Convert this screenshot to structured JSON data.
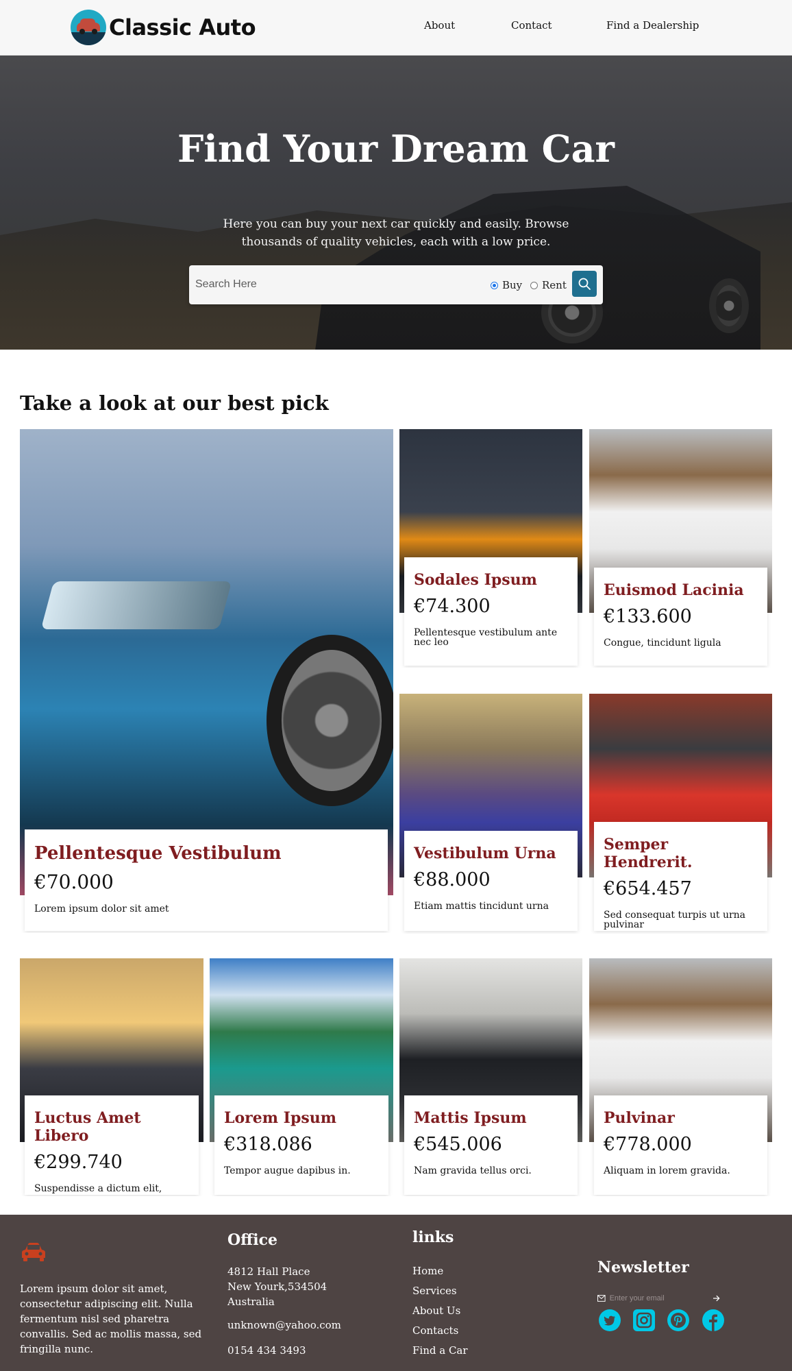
{
  "brand": {
    "name": "Classic Auto"
  },
  "nav": {
    "about": "About",
    "contact": "Contact",
    "dealership": "Find a Dealership"
  },
  "hero": {
    "title": "Find Your Dream Car",
    "subtitle": "Here you can buy your next car quickly and easily. Browse thousands of quality vehicles, each with a low price.",
    "search_placeholder": "Search Here",
    "radio_buy": "Buy",
    "radio_rent": "Rent",
    "selected_mode": "Buy"
  },
  "best_pick": {
    "title": "Take a look at our best pick",
    "featured": {
      "name": "Pellentesque Vestibulum",
      "price": "€70.000",
      "desc": "Lorem ipsum dolor sit amet"
    },
    "items": [
      {
        "name": "Sodales Ipsum",
        "price": "€74.300",
        "desc": "Pellentesque vestibulum ante nec leo"
      },
      {
        "name": "Euismod Lacinia",
        "price": "€133.600",
        "desc": "Congue, tincidunt ligula"
      },
      {
        "name": "Vestibulum Urna",
        "price": "€88.000",
        "desc": "Etiam mattis tincidunt urna"
      },
      {
        "name": "Semper Hendrerit.",
        "price": "€654.457",
        "desc": "Sed consequat turpis ut urna pulvinar"
      },
      {
        "name": "Luctus Amet Libero",
        "price": "€299.740",
        "desc": "Suspendisse a dictum elit,"
      },
      {
        "name": "Lorem Ipsum",
        "price": "€318.086",
        "desc": "Tempor augue dapibus in."
      },
      {
        "name": "Mattis Ipsum",
        "price": "€545.006",
        "desc": "Nam gravida tellus orci."
      },
      {
        "name": "Pulvinar",
        "price": "€778.000",
        "desc": "Aliquam in lorem gravida."
      }
    ]
  },
  "footer": {
    "about_text": "Lorem ipsum dolor sit amet, consectetur adipiscing elit. Nulla fermentum nisl sed pharetra convallis. Sed ac mollis massa, sed fringilla nunc.",
    "office_title": "Office",
    "address_line1": "4812 Hall Place",
    "address_line2": "New Yourk,534504",
    "address_line3": "Australia",
    "email": "unknown@yahoo.com",
    "phone": "0154 434 3493",
    "links_title": "links",
    "links": [
      "Home",
      "Services",
      "About Us",
      "Contacts",
      "Find a Car"
    ],
    "newsletter_title": "Newsletter",
    "newsletter_placeholder": "Enter your email",
    "social_color": "#00c8e6",
    "accent_color": "#c9401f"
  }
}
